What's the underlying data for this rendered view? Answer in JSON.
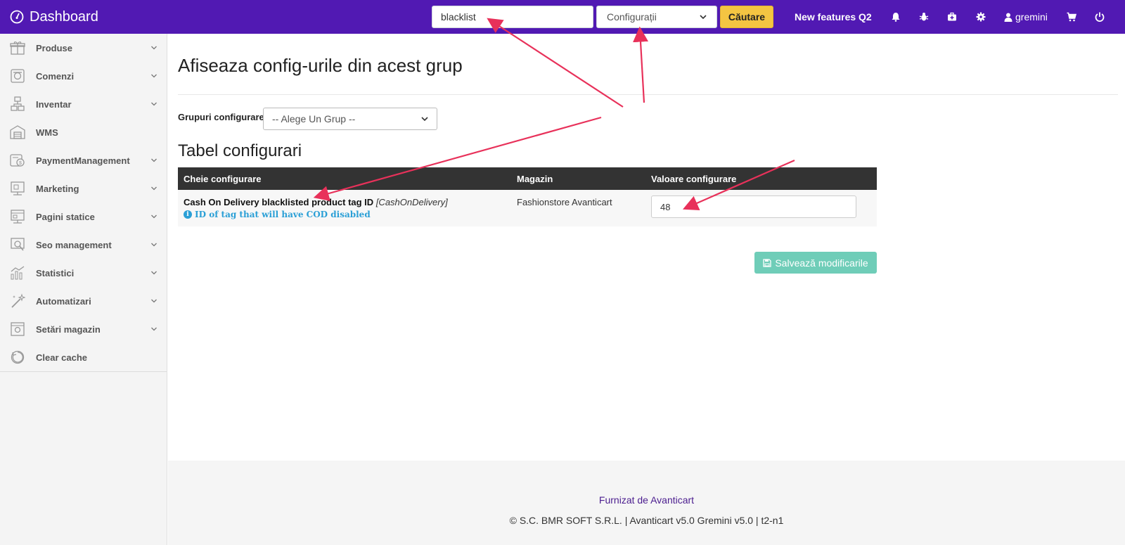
{
  "navbar": {
    "brand": "Dashboard",
    "search_value": "blacklist",
    "search_type": "Configurații",
    "search_button": "Căutare",
    "new_features": "New features Q2",
    "username": "gremini",
    "icons": [
      "bell-icon",
      "bug-icon",
      "medkit-icon",
      "gear-icon",
      "user-icon",
      "cart-icon",
      "power-icon"
    ]
  },
  "sidebar": {
    "items": [
      {
        "label": "Produse",
        "icon": "gift-icon",
        "has_submenu": true
      },
      {
        "label": "Comenzi",
        "icon": "orders-icon",
        "has_submenu": true
      },
      {
        "label": "Inventar",
        "icon": "boxes-icon",
        "has_submenu": true
      },
      {
        "label": "WMS",
        "icon": "warehouse-icon",
        "has_submenu": false
      },
      {
        "label": "PaymentManagement",
        "icon": "payment-icon",
        "has_submenu": true
      },
      {
        "label": "Marketing",
        "icon": "marketing-icon",
        "has_submenu": true
      },
      {
        "label": "Pagini statice",
        "icon": "pages-icon",
        "has_submenu": true
      },
      {
        "label": "Seo management",
        "icon": "seo-icon",
        "has_submenu": true
      },
      {
        "label": "Statistici",
        "icon": "chart-icon",
        "has_submenu": true
      },
      {
        "label": "Automatizari",
        "icon": "wand-icon",
        "has_submenu": true
      },
      {
        "label": "Setări magazin",
        "icon": "settings-icon",
        "has_submenu": true
      },
      {
        "label": "Clear cache",
        "icon": "cache-icon",
        "has_submenu": false
      }
    ]
  },
  "main": {
    "title": "Afiseaza config-urile din acest grup",
    "group_label": "Grupuri configurare",
    "group_select": "-- Alege Un Grup --",
    "table_title": "Tabel configurari",
    "columns": [
      "Cheie configurare",
      "Magazin",
      "Valoare configurare"
    ],
    "rows": [
      {
        "key_name": "Cash On Delivery blacklisted product tag ID",
        "key_code": "[CashOnDelivery]",
        "help": "ID of tag that will have COD disabled",
        "store": "Fashionstore Avanticart",
        "value": "48"
      }
    ],
    "save_button": "Salvează modificarile"
  },
  "footer": {
    "link": "Furnizat de Avanticart",
    "copyright": "© S.C. BMR SOFT S.R.L. | Avanticart v5.0 Gremini v5.0 | t2-n1"
  },
  "colors": {
    "navbar": "#5119b3",
    "search_button": "#f4c542",
    "save_button": "#6fcdb8",
    "table_header": "#333333",
    "help_text": "#2a9fd6",
    "annotation_arrow": "#e8315a"
  }
}
